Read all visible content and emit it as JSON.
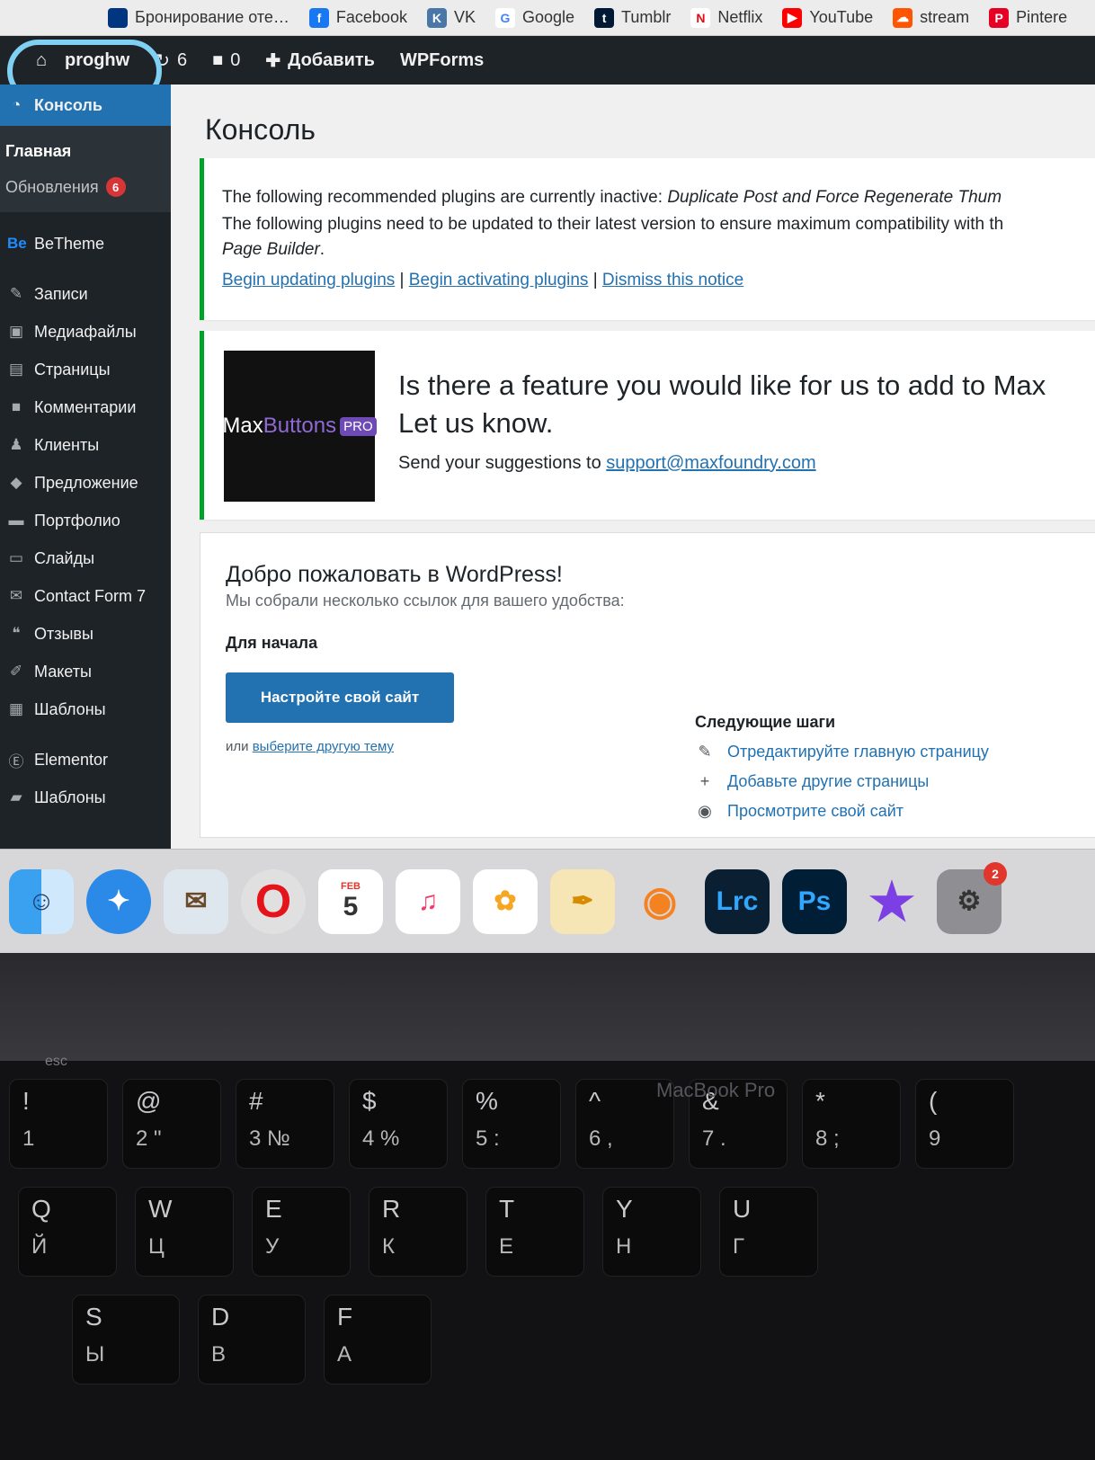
{
  "bookmarks": [
    {
      "label": "Бронирование оте…",
      "icon": "booking-icon",
      "color": "#003580"
    },
    {
      "label": "Facebook",
      "icon": "facebook-icon",
      "color": "#1877f2",
      "glyph": "f"
    },
    {
      "label": "VK",
      "icon": "vk-icon",
      "color": "#4a76a8",
      "glyph": "K"
    },
    {
      "label": "Google",
      "icon": "google-icon",
      "color": "#ffffff",
      "glyph": "G"
    },
    {
      "label": "Tumblr",
      "icon": "tumblr-icon",
      "color": "#001935",
      "glyph": "t"
    },
    {
      "label": "Netflix",
      "icon": "netflix-icon",
      "color": "#ffffff",
      "glyph": "N"
    },
    {
      "label": "YouTube",
      "icon": "youtube-icon",
      "color": "#ff0000",
      "glyph": "▶"
    },
    {
      "label": "stream",
      "icon": "soundcloud-icon",
      "color": "#ff5500",
      "glyph": "☁"
    },
    {
      "label": "Pintere",
      "icon": "pinterest-icon",
      "color": "#e60023",
      "glyph": "P"
    }
  ],
  "adminbar": {
    "site_name": "proghw",
    "updates_count": "6",
    "comments_count": "0",
    "new_label": "Добавить",
    "wpforms_label": "WPForms"
  },
  "sidebar": {
    "current": "Консоль",
    "sub": {
      "home": "Главная",
      "updates": "Обновления",
      "updates_badge": "6"
    },
    "items": [
      {
        "label": "BeTheme",
        "icon": "betheme-icon",
        "glyph": "Be"
      },
      {
        "label": "Записи",
        "icon": "pin-icon",
        "glyph": "✎"
      },
      {
        "label": "Медиафайлы",
        "icon": "media-icon",
        "glyph": "▣"
      },
      {
        "label": "Страницы",
        "icon": "pages-icon",
        "glyph": "▤"
      },
      {
        "label": "Комментарии",
        "icon": "comment-icon",
        "glyph": "■"
      },
      {
        "label": "Клиенты",
        "icon": "clients-icon",
        "glyph": "♟"
      },
      {
        "label": "Предложение",
        "icon": "offer-icon",
        "glyph": "◆"
      },
      {
        "label": "Портфолио",
        "icon": "portfolio-icon",
        "glyph": "▬"
      },
      {
        "label": "Слайды",
        "icon": "slides-icon",
        "glyph": "▭"
      },
      {
        "label": "Contact Form 7",
        "icon": "mail-icon",
        "glyph": "✉"
      },
      {
        "label": "Отзывы",
        "icon": "quote-icon",
        "glyph": "❝"
      },
      {
        "label": "Макеты",
        "icon": "layouts-icon",
        "glyph": "✐"
      },
      {
        "label": "Шаблоны",
        "icon": "templates-icon",
        "glyph": "▦"
      },
      {
        "label": "Elementor",
        "icon": "elementor-icon",
        "glyph": "Ⓔ"
      },
      {
        "label": "Шаблоны",
        "icon": "folder-icon",
        "glyph": "▰"
      }
    ]
  },
  "main": {
    "title": "Консоль",
    "tgm": {
      "line1_prefix": "The following recommended plugins are currently inactive: ",
      "line1_plugins": "Duplicate Post and Force Regenerate Thum",
      "line2_prefix": "The following plugins need to be updated to their latest version to ensure maximum compatibility with th",
      "line2_plugins": "Page Builder",
      "link_update": "Begin updating plugins",
      "link_activate": "Begin activating plugins",
      "link_dismiss": "Dismiss this notice",
      "separator": "|"
    },
    "maxbuttons": {
      "logo_max": "Max",
      "logo_buttons": "Buttons",
      "logo_pro": "PRO",
      "heading": "Is there a feature you would like for us to add to Max",
      "heading2": "Let us know.",
      "send_prefix": "Send your suggestions to ",
      "email": "support@maxfoundry.com"
    },
    "welcome": {
      "title": "Добро пожаловать в WordPress!",
      "about": "Мы собрали несколько ссылок для вашего удобства:",
      "get_started": "Для начала",
      "customize_button": "Настройте свой сайт",
      "or": "или ",
      "alt_theme_link": "выберите другую тему",
      "next_steps_title": "Следующие шаги",
      "next_steps": [
        {
          "label": "Отредактируйте главную страницу",
          "icon": "edit-page-icon",
          "glyph": "✎"
        },
        {
          "label": "Добавьте другие страницы",
          "icon": "plus-icon",
          "glyph": "+"
        },
        {
          "label": "Просмотрите свой сайт",
          "icon": "view-site-icon",
          "glyph": "◉"
        }
      ]
    }
  },
  "dock": {
    "calendar_month": "FEB",
    "calendar_day": "5",
    "lrc": "Lrc",
    "ps": "Ps",
    "prefs_badge": "2"
  },
  "laptop": {
    "brand": "MacBook Pro",
    "esc": "esc"
  },
  "keys": [
    {
      "main": "!",
      "alt": "1"
    },
    {
      "main": "@",
      "alt": "2 \""
    },
    {
      "main": "#",
      "alt": "3 №"
    },
    {
      "main": "$",
      "alt": "4 %"
    },
    {
      "main": "%",
      "alt": "5 :"
    },
    {
      "main": "^",
      "alt": "6 ,"
    },
    {
      "main": "&",
      "alt": "7 ."
    },
    {
      "main": "*",
      "alt": "8 ;"
    },
    {
      "main": "(",
      "alt": "9"
    },
    {
      "main": "Q",
      "alt": "Й"
    },
    {
      "main": "W",
      "alt": "Ц"
    },
    {
      "main": "E",
      "alt": "У"
    },
    {
      "main": "R",
      "alt": "К"
    },
    {
      "main": "T",
      "alt": "Е"
    },
    {
      "main": "Y",
      "alt": "Н"
    },
    {
      "main": "U",
      "alt": "Г"
    },
    {
      "main": "S",
      "alt": "Ы"
    },
    {
      "main": "D",
      "alt": "В"
    },
    {
      "main": "F",
      "alt": "А"
    }
  ]
}
